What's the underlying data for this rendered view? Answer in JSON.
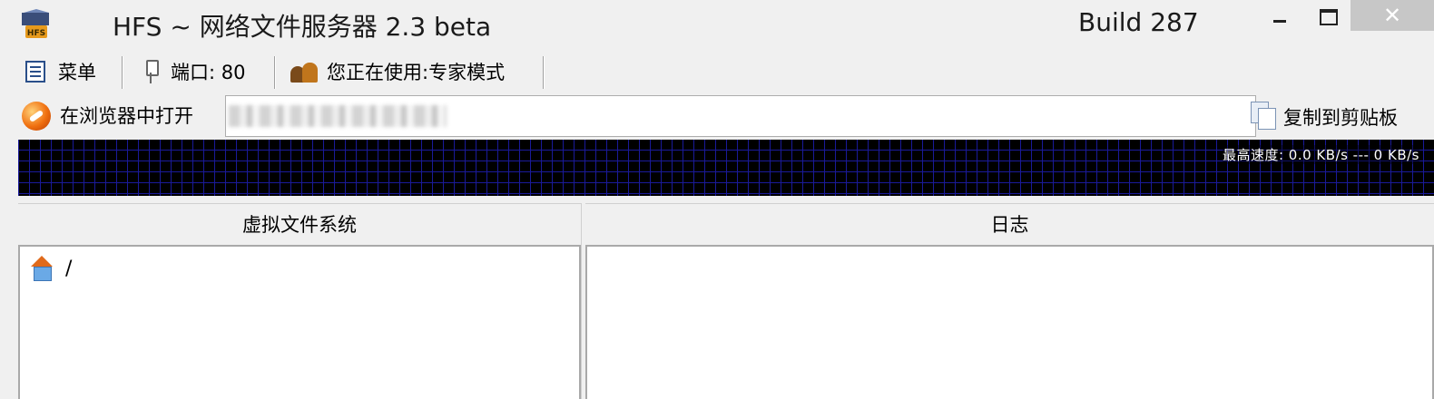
{
  "window": {
    "title": "HFS ~ 网络文件服务器 2.3 beta",
    "build": "Build 287",
    "close_symbol": "✕"
  },
  "icons": {
    "app": "hfs-logo-icon",
    "menu": "menu-icon",
    "port": "port-plug-icon",
    "mode": "users-icon",
    "browser": "browser-icon",
    "copy": "copy-icon",
    "home": "home-icon"
  },
  "toolbar": {
    "menu_label": "菜单",
    "port_label": "端口: 80",
    "mode_label": "您正在使用:专家模式"
  },
  "address": {
    "open_label": "在浏览器中打开",
    "url_value": "",
    "copy_label": "复制到剪贴板"
  },
  "graph": {
    "speed_text": "最高速度: 0.0 KB/s --- 0 KB/s"
  },
  "panels": {
    "vfs_header": "虚拟文件系统",
    "log_header": "日志",
    "vfs_items": [
      {
        "label": "/"
      }
    ]
  },
  "colors": {
    "graph_bg": "#000000",
    "graph_grid": "#1a1a9a",
    "close_hover": "#c7c7c7"
  }
}
